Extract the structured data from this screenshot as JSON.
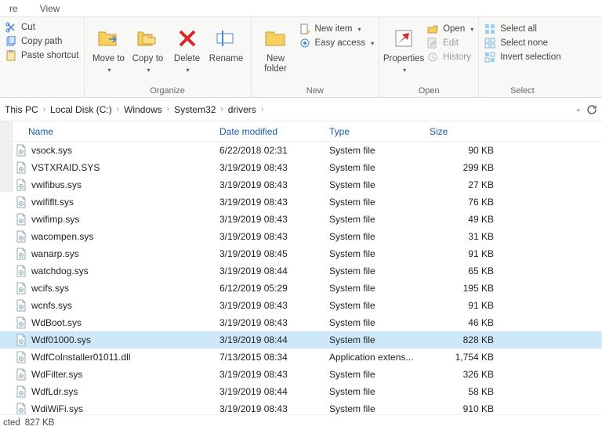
{
  "tabs": {
    "share": "re",
    "view": "View"
  },
  "ribbon": {
    "clipboard": {
      "cut": "Cut",
      "copy_path": "Copy path",
      "paste_shortcut": "Paste shortcut"
    },
    "organize": {
      "move_to": "Move\nto",
      "copy_to": "Copy\nto",
      "delete": "Delete",
      "rename": "Rename",
      "title": "Organize"
    },
    "new": {
      "new_folder": "New\nfolder",
      "new_item": "New item",
      "easy_access": "Easy access",
      "title": "New"
    },
    "open": {
      "properties": "Properties",
      "open": "Open",
      "edit": "Edit",
      "history": "History",
      "title": "Open"
    },
    "select": {
      "select_all": "Select all",
      "select_none": "Select none",
      "invert": "Invert selection",
      "title": "Select"
    }
  },
  "breadcrumb": [
    "This PC",
    "Local Disk (C:)",
    "Windows",
    "System32",
    "drivers"
  ],
  "columns": {
    "name": "Name",
    "date": "Date modified",
    "type": "Type",
    "size": "Size"
  },
  "files": [
    {
      "name": "vsock.sys",
      "date": "6/22/2018 02:31",
      "type": "System file",
      "size": "90 KB",
      "sel": false
    },
    {
      "name": "VSTXRAID.SYS",
      "date": "3/19/2019 08:43",
      "type": "System file",
      "size": "299 KB",
      "sel": false
    },
    {
      "name": "vwifibus.sys",
      "date": "3/19/2019 08:43",
      "type": "System file",
      "size": "27 KB",
      "sel": false
    },
    {
      "name": "vwififlt.sys",
      "date": "3/19/2019 08:43",
      "type": "System file",
      "size": "76 KB",
      "sel": false
    },
    {
      "name": "vwifimp.sys",
      "date": "3/19/2019 08:43",
      "type": "System file",
      "size": "49 KB",
      "sel": false
    },
    {
      "name": "wacompen.sys",
      "date": "3/19/2019 08:43",
      "type": "System file",
      "size": "31 KB",
      "sel": false
    },
    {
      "name": "wanarp.sys",
      "date": "3/19/2019 08:45",
      "type": "System file",
      "size": "91 KB",
      "sel": false
    },
    {
      "name": "watchdog.sys",
      "date": "3/19/2019 08:44",
      "type": "System file",
      "size": "65 KB",
      "sel": false
    },
    {
      "name": "wcifs.sys",
      "date": "6/12/2019 05:29",
      "type": "System file",
      "size": "195 KB",
      "sel": false
    },
    {
      "name": "wcnfs.sys",
      "date": "3/19/2019 08:43",
      "type": "System file",
      "size": "91 KB",
      "sel": false
    },
    {
      "name": "WdBoot.sys",
      "date": "3/19/2019 08:43",
      "type": "System file",
      "size": "46 KB",
      "sel": false
    },
    {
      "name": "Wdf01000.sys",
      "date": "3/19/2019 08:44",
      "type": "System file",
      "size": "828 KB",
      "sel": true
    },
    {
      "name": "WdfCoInstaller01011.dll",
      "date": "7/13/2015 08:34",
      "type": "Application extens...",
      "size": "1,754 KB",
      "sel": false
    },
    {
      "name": "WdFilter.sys",
      "date": "3/19/2019 08:43",
      "type": "System file",
      "size": "326 KB",
      "sel": false
    },
    {
      "name": "WdfLdr.sys",
      "date": "3/19/2019 08:44",
      "type": "System file",
      "size": "58 KB",
      "sel": false
    },
    {
      "name": "WdiWiFi.sys",
      "date": "3/19/2019 08:43",
      "type": "System file",
      "size": "910 KB",
      "sel": false
    }
  ],
  "status": {
    "selected": "cted",
    "size": "827 KB"
  }
}
